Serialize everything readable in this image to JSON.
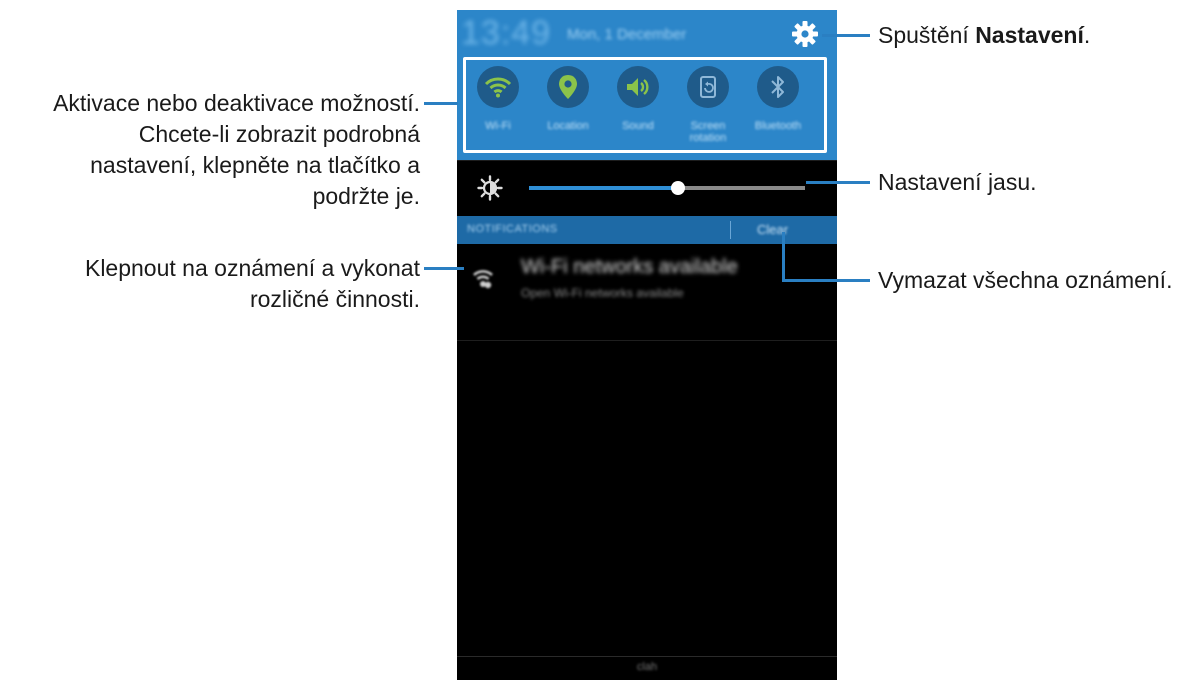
{
  "phone": {
    "status": {
      "time": "13:49",
      "date": "Mon, 1 December"
    },
    "quick_settings": [
      {
        "label": "Wi-Fi",
        "icon": "wifi-icon",
        "active": true
      },
      {
        "label": "Location",
        "icon": "location-pin-icon",
        "active": true
      },
      {
        "label": "Sound",
        "icon": "sound-icon",
        "active": true
      },
      {
        "label": "Screen rotation",
        "icon": "screen-rotation-icon",
        "active": false
      },
      {
        "label": "Bluetooth",
        "icon": "bluetooth-icon",
        "active": false
      }
    ],
    "brightness": {
      "icon": "brightness-icon",
      "level": 0.54
    },
    "notifications": {
      "header": "NOTIFICATIONS",
      "clear_label": "Clear",
      "items": [
        {
          "icon": "wifi-notification-icon",
          "title": "Wi-Fi networks available",
          "subtitle": "Open Wi-Fi networks available"
        }
      ]
    },
    "bottom_label": "clah"
  },
  "callouts": {
    "settings_prefix": "Spuštění ",
    "settings_bold": "Nastavení",
    "settings_suffix": ".",
    "toggles_line1": "Aktivace nebo deaktivace možností.",
    "toggles_line2": "Chcete-li zobrazit podrobná",
    "toggles_line3": "nastavení, klepněte na tlačítko a",
    "toggles_line4": "podržte je.",
    "brightness": "Nastavení jasu.",
    "notification_line1": "Klepnout na oznámení a vykonat",
    "notification_line2": "rozličné činnosti.",
    "clear": "Vymazat všechna oznámení."
  },
  "colors": {
    "accent": "#2c86c9",
    "callout_line": "#2a7fc2",
    "toggle_active": "#8bc34a",
    "toggle_inactive": "#8fb8d8"
  }
}
